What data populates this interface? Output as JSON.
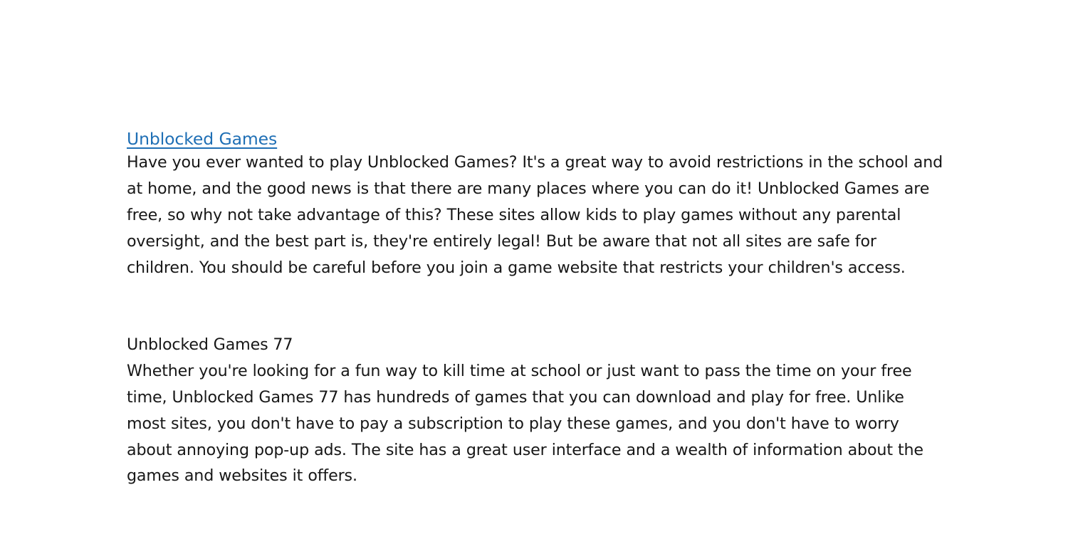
{
  "document": {
    "heading_link": {
      "label": "Unblocked Games",
      "color": "#1F6FB5",
      "underlined": "true"
    },
    "paragraphs": [
      {
        "id": "intro",
        "text": "Have you ever wanted to play Unblocked Games? It's a great way to avoid restrictions in the school and at home, and the good news is that there are many places where you can do it! Unblocked Games are free, so why not take advantage of this? These sites allow kids to play games without any parental oversight, and the best part is, they're entirely legal! But be aware that not all sites are safe for children. You should be careful before you join a game website that restricts your children's access."
      }
    ],
    "section": {
      "subheading": "Unblocked Games 77",
      "paragraph": "Whether you're looking for a fun way to kill time at school or just want to pass the time on your free time, Unblocked Games 77 has hundreds of games that you can download and play for free. Unlike most sites, you don't have to pay a subscription to play these games, and you don't have to worry about annoying pop-up ads. The site has a great user interface and a wealth of information about the games and websites it offers."
    },
    "colors": {
      "background": "#FFFFFF",
      "body_text": "#171717",
      "link": "#1F6FB5"
    }
  }
}
